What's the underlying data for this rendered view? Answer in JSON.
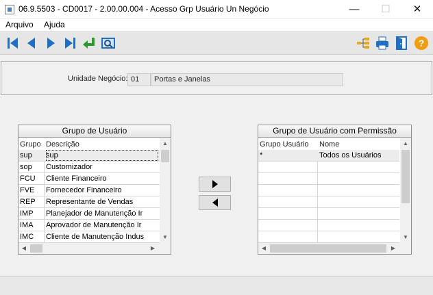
{
  "window": {
    "title": "06.9.5503 - CD0017 - 2.00.00.004 - Acesso Grp Usuário Un Negócio",
    "minimize": "—",
    "maximize": "☐",
    "close": "✕"
  },
  "menu": {
    "items": [
      "Arquivo",
      "Ajuda"
    ]
  },
  "toolbar": {
    "left_buttons": [
      "first-record-icon",
      "previous-record-icon",
      "next-record-icon",
      "last-record-icon",
      "confirm-return-icon",
      "search-preview-icon"
    ],
    "right_buttons": [
      "tree-structure-icon",
      "print-icon",
      "exit-door-icon",
      "help-icon"
    ]
  },
  "business_unit": {
    "label": "Unidade Negócio:",
    "code": "01",
    "name": "Portas e Janelas"
  },
  "user_groups": {
    "title": "Grupo de Usuário",
    "columns": [
      "Grupo",
      "Descrição"
    ],
    "rows": [
      {
        "code": "sup",
        "description": "sup"
      },
      {
        "code": "sop",
        "description": "Customizador"
      },
      {
        "code": "FCU",
        "description": "Cliente Financeiro"
      },
      {
        "code": "FVE",
        "description": "Fornecedor Financeiro"
      },
      {
        "code": "REP",
        "description": "Representante de Vendas"
      },
      {
        "code": "IMP",
        "description": "Planejador de Manutenção Ir"
      },
      {
        "code": "IMA",
        "description": "Aprovador de Manutenção Ir"
      },
      {
        "code": "IMC",
        "description": "Cliente de Manutenção Indus"
      }
    ]
  },
  "permitted_groups": {
    "title": "Grupo de Usuário com Permissão",
    "columns": [
      "Grupo Usuário",
      "Nome"
    ],
    "rows": [
      {
        "code": "*",
        "name": "Todos os Usuários"
      }
    ]
  },
  "colors": {
    "toolbar_icon_blue": "#1f6fc5",
    "confirm_green": "#2e9a2e",
    "help_orange": "#f39c12"
  }
}
